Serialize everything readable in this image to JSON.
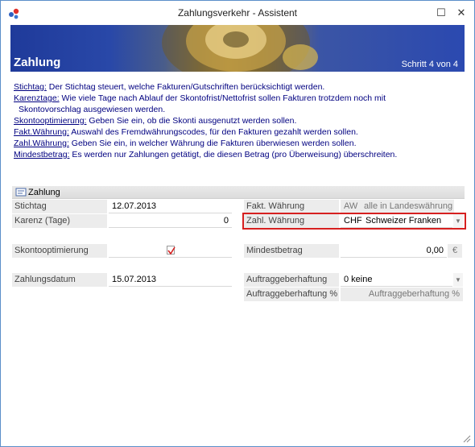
{
  "window": {
    "title": "Zahlungsverkehr - Assistent",
    "maximize_glyph": "☐",
    "close_glyph": "✕"
  },
  "banner": {
    "title": "Zahlung",
    "step": "Schritt 4 von 4"
  },
  "help": [
    {
      "term": "Stichtag:",
      "text": " Der Stichtag steuert, welche Fakturen/Gutschriften berücksichtigt werden."
    },
    {
      "term": "Karenztage:",
      "text": "  Wie viele Tage nach Ablauf der Skontofrist/Nettofrist sollen Fakturen trotzdem noch mit"
    },
    {
      "term": "",
      "text": "Skontovorschlag ausgewiesen werden."
    },
    {
      "term": "Skontooptimierung:",
      "text": "  Geben Sie ein, ob die Skonti ausgenutzt werden sollen."
    },
    {
      "term": "Fakt.Währung:",
      "text": "  Auswahl des Fremdwährungscodes, für den Fakturen gezahlt werden sollen."
    },
    {
      "term": "Zahl.Währung:",
      "text": "  Geben Sie ein, in welcher Währung die Fakturen überwiesen werden sollen."
    },
    {
      "term": "Mindestbetrag:",
      "text": "  Es werden nur Zahlungen getätigt, die diesen Betrag (pro Überweisung) überschreiten."
    }
  ],
  "section": {
    "label": "Zahlung",
    "icon": "form-icon"
  },
  "fields": {
    "stichtag": {
      "label": "Stichtag",
      "value": "12.07.2013"
    },
    "karenz": {
      "label": "Karenz (Tage)",
      "value": "0"
    },
    "skonto": {
      "label": "Skontooptimierung",
      "checked": true
    },
    "zahlungsdatum": {
      "label": "Zahlungsdatum",
      "value": "15.07.2013"
    },
    "fakt_waehrung": {
      "label": "Fakt. Währung",
      "code": "AW",
      "value": "alle in Landeswährung"
    },
    "zahl_waehrung": {
      "label": "Zahl. Währung",
      "code": "CHF",
      "value": "Schweizer Franken"
    },
    "mindestbetrag": {
      "label": "Mindestbetrag",
      "value": "0,00",
      "unit": "€"
    },
    "auftraggeberhaftung": {
      "label": "Auftraggeberhaftung",
      "value": "0 keine"
    },
    "auftraggeberhaftung_pct": {
      "label": "Auftraggeberhaftung %",
      "value": "Auftraggeberhaftung %"
    }
  },
  "colors": {
    "highlight": "#d62020",
    "help_text": "#000080"
  }
}
